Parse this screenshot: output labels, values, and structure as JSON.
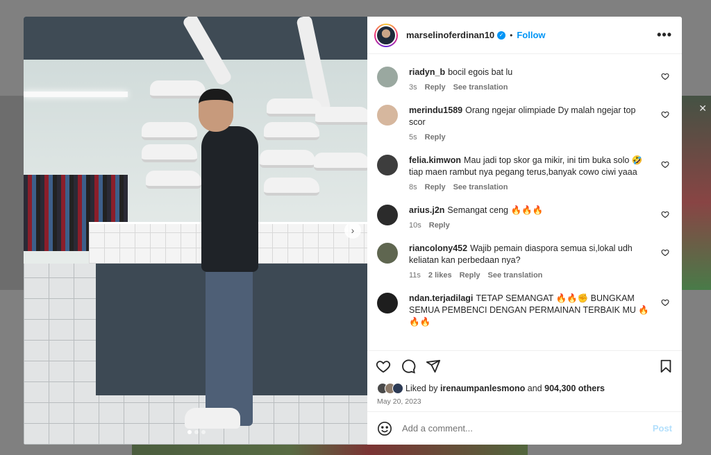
{
  "post": {
    "username": "marselinoferdinan10",
    "separator": "•",
    "follow_label": "Follow",
    "more_label": "•••",
    "verified_badge": "✓"
  },
  "photo": {
    "next_label": "›"
  },
  "comments": [
    {
      "user": "riadyn_b",
      "text": "bocil egois bat lu",
      "time": "3s",
      "likes": "",
      "reply": "Reply",
      "translate": "See translation",
      "avatar_color": "#9aa8a0"
    },
    {
      "user": "merindu1589",
      "text": "Orang ngejar olimpiade Dy malah ngejar top scor",
      "time": "5s",
      "likes": "",
      "reply": "Reply",
      "translate": "",
      "avatar_color": "#d6b79e"
    },
    {
      "user": "felia.kimwon",
      "text": "Mau jadi top skor ga mikir, ini tim buka solo 🤣 tiap maen rambut nya pegang terus,banyak cowo ciwi yaaa",
      "time": "8s",
      "likes": "",
      "reply": "Reply",
      "translate": "See translation",
      "avatar_color": "#3d3d3d"
    },
    {
      "user": "arius.j2n",
      "text": "Semangat ceng 🔥🔥🔥",
      "time": "10s",
      "likes": "",
      "reply": "Reply",
      "translate": "",
      "avatar_color": "#2b2b2b"
    },
    {
      "user": "riancolony452",
      "text": "Wajib pemain diaspora semua si,lokal udh keliatan kan perbedaan nya?",
      "time": "11s",
      "likes": "2 likes",
      "reply": "Reply",
      "translate": "See translation",
      "avatar_color": "#5f6650"
    },
    {
      "user": "ndan.terjadilagi",
      "text": "TETAP SEMANGAT 🔥🔥✊ BUNGKAM SEMUA PEMBENCI DENGAN PERMAINAN TERBAIK MU 🔥🔥🔥",
      "time": "",
      "likes": "",
      "reply": "",
      "translate": "",
      "avatar_color": "#1e1e1e"
    }
  ],
  "likes": {
    "prefix": "Liked by",
    "user": "irenaumpanlesmono",
    "and": "and",
    "count": "904,300 others"
  },
  "date": "May 20, 2023",
  "add_comment": {
    "placeholder": "Add a comment...",
    "post_label": "Post"
  },
  "colors": {
    "accent": "#0095f6",
    "text": "#262626",
    "muted": "#737373"
  },
  "icons": {
    "like": "heart-icon",
    "comment": "comment-icon",
    "share": "share-icon",
    "save": "bookmark-icon",
    "emoji": "emoji-icon"
  }
}
